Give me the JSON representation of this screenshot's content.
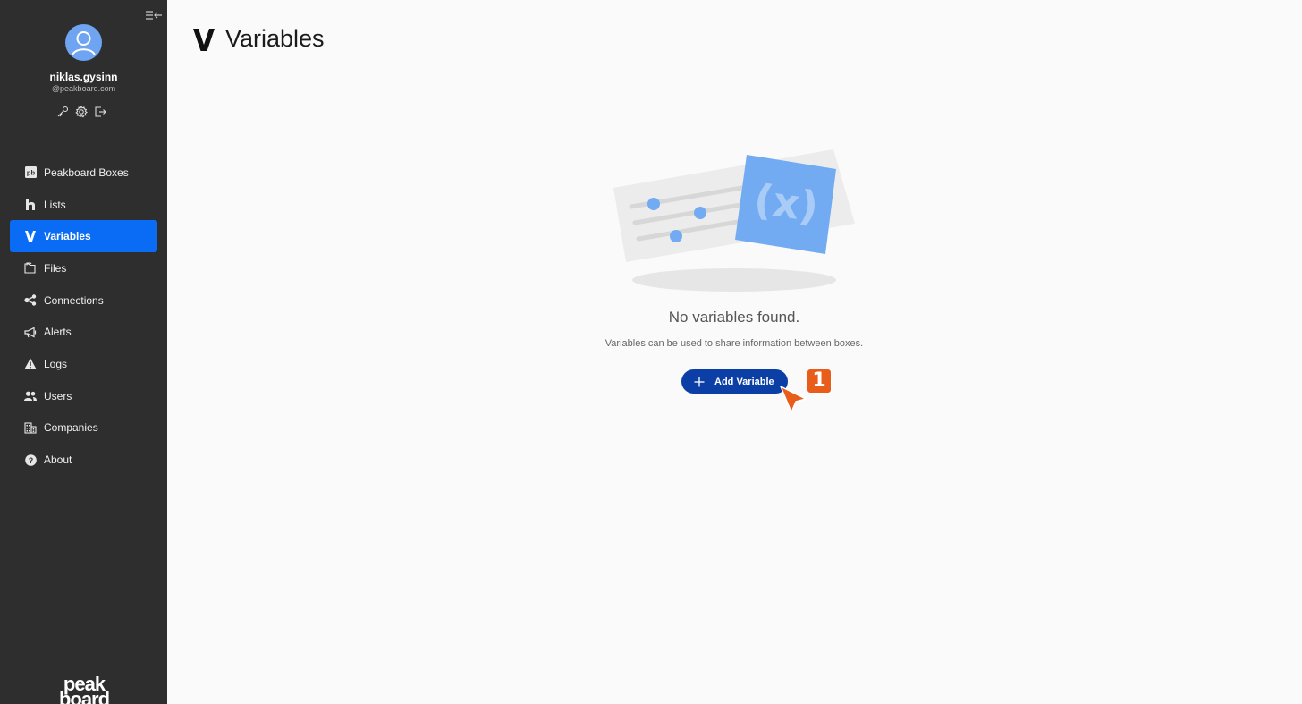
{
  "sidebar": {
    "user": {
      "name": "niklas.gysinn",
      "email": "@peakboard.com"
    },
    "items": [
      {
        "label": "Peakboard Boxes",
        "icon": "peakboard-box-icon"
      },
      {
        "label": "Lists",
        "icon": "lists-icon"
      },
      {
        "label": "Variables",
        "icon": "variables-icon",
        "active": true
      },
      {
        "label": "Files",
        "icon": "files-icon"
      },
      {
        "label": "Connections",
        "icon": "connections-icon"
      },
      {
        "label": "Alerts",
        "icon": "megaphone-icon"
      },
      {
        "label": "Logs",
        "icon": "warning-icon"
      },
      {
        "label": "Users",
        "icon": "users-icon"
      },
      {
        "label": "Companies",
        "icon": "companies-icon"
      },
      {
        "label": "About",
        "icon": "help-icon"
      }
    ],
    "brand": {
      "line1": "peak",
      "line2": "board"
    },
    "active_color": "#0a6cf5",
    "background_color": "#2e2e2e"
  },
  "main": {
    "title": "Variables",
    "empty_title": "No variables found.",
    "empty_subtitle": "Variables can be used to share information between boxes.",
    "illustration_label": "(x)",
    "add_button_label": "Add Variable",
    "add_button_color": "#0b3fa5"
  },
  "annotation": {
    "step_badge": "1",
    "badge_color": "#e85d1a"
  }
}
